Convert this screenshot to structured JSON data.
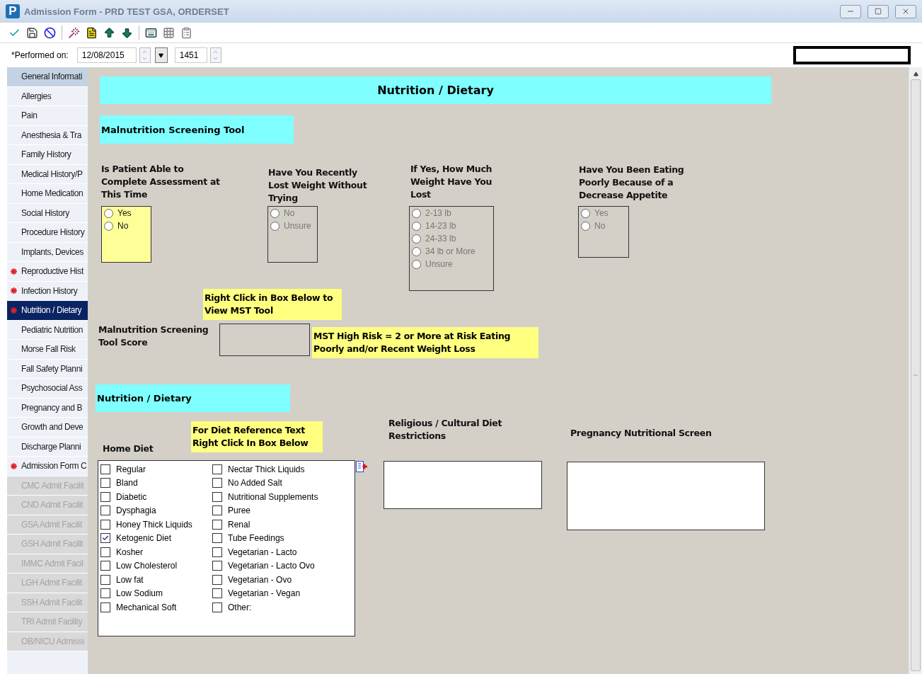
{
  "window": {
    "logo_letter": "P",
    "title": "Admission Form - PRD TEST GSA, ORDERSET"
  },
  "performed": {
    "label": "*Performed on:",
    "date": "12/08/2015",
    "time": "1451"
  },
  "sidebar": {
    "items": [
      {
        "label": "General Informati",
        "selected": false,
        "required": false,
        "disabled": false,
        "highlighted": true
      },
      {
        "label": "Allergies",
        "selected": false,
        "required": false,
        "disabled": false,
        "highlighted": false
      },
      {
        "label": "Pain",
        "selected": false,
        "required": false,
        "disabled": false,
        "highlighted": false
      },
      {
        "label": "Anesthesia & Tra",
        "selected": false,
        "required": false,
        "disabled": false,
        "highlighted": false
      },
      {
        "label": "Family History",
        "selected": false,
        "required": false,
        "disabled": false,
        "highlighted": false
      },
      {
        "label": "Medical History/P",
        "selected": false,
        "required": false,
        "disabled": false,
        "highlighted": false
      },
      {
        "label": "Home Medication",
        "selected": false,
        "required": false,
        "disabled": false,
        "highlighted": false
      },
      {
        "label": "Social History",
        "selected": false,
        "required": false,
        "disabled": false,
        "highlighted": false
      },
      {
        "label": "Procedure History",
        "selected": false,
        "required": false,
        "disabled": false,
        "highlighted": false
      },
      {
        "label": "Implants, Devices",
        "selected": false,
        "required": false,
        "disabled": false,
        "highlighted": false
      },
      {
        "label": "Reproductive Hist",
        "selected": false,
        "required": true,
        "disabled": false,
        "highlighted": false
      },
      {
        "label": "Infection History",
        "selected": false,
        "required": true,
        "disabled": false,
        "highlighted": false
      },
      {
        "label": "Nutrition / Dietary",
        "selected": true,
        "required": true,
        "disabled": false,
        "highlighted": false
      },
      {
        "label": "Pediatric Nutrition",
        "selected": false,
        "required": false,
        "disabled": false,
        "highlighted": false
      },
      {
        "label": "Morse Fall Risk",
        "selected": false,
        "required": false,
        "disabled": false,
        "highlighted": false
      },
      {
        "label": "Fall Safety Planni",
        "selected": false,
        "required": false,
        "disabled": false,
        "highlighted": false
      },
      {
        "label": "Psychosocial Ass",
        "selected": false,
        "required": false,
        "disabled": false,
        "highlighted": false
      },
      {
        "label": "Pregnancy and B",
        "selected": false,
        "required": false,
        "disabled": false,
        "highlighted": false
      },
      {
        "label": "Growth and Deve",
        "selected": false,
        "required": false,
        "disabled": false,
        "highlighted": false
      },
      {
        "label": "Discharge Planni",
        "selected": false,
        "required": false,
        "disabled": false,
        "highlighted": false
      },
      {
        "label": "Admission Form C",
        "selected": false,
        "required": true,
        "disabled": false,
        "highlighted": false
      },
      {
        "label": "CMC Admit Facilit",
        "selected": false,
        "required": false,
        "disabled": true,
        "highlighted": false
      },
      {
        "label": "CND Admit Facilit",
        "selected": false,
        "required": false,
        "disabled": true,
        "highlighted": false
      },
      {
        "label": "GSA Admit Facilit",
        "selected": false,
        "required": false,
        "disabled": true,
        "highlighted": false
      },
      {
        "label": "GSH Admit Facilit",
        "selected": false,
        "required": false,
        "disabled": true,
        "highlighted": false
      },
      {
        "label": "IMMC Admit Facil",
        "selected": false,
        "required": false,
        "disabled": true,
        "highlighted": false
      },
      {
        "label": "LGH Admit Facilit",
        "selected": false,
        "required": false,
        "disabled": true,
        "highlighted": false
      },
      {
        "label": "SSH Admit Facilit",
        "selected": false,
        "required": false,
        "disabled": true,
        "highlighted": false
      },
      {
        "label": "TRI Admit Facility",
        "selected": false,
        "required": false,
        "disabled": true,
        "highlighted": false
      },
      {
        "label": "OB/NICU Admissi",
        "selected": false,
        "required": false,
        "disabled": true,
        "highlighted": false
      }
    ]
  },
  "form": {
    "title": "Nutrition / Dietary",
    "mst_header": "Malnutrition Screening Tool",
    "questions": [
      {
        "label": "Is Patient Able to Complete Assessment at This Time",
        "required": true,
        "disabled": false,
        "options": [
          {
            "label": "Yes",
            "selected": false
          },
          {
            "label": "No",
            "selected": false
          }
        ]
      },
      {
        "label": "Have You Recently Lost Weight Without Trying",
        "required": false,
        "disabled": true,
        "options": [
          {
            "label": "No",
            "selected": false
          },
          {
            "label": "Unsure",
            "selected": false
          }
        ]
      },
      {
        "label": "If Yes, How Much Weight Have You Lost",
        "required": false,
        "disabled": true,
        "options": [
          {
            "label": "2-13 lb",
            "selected": false
          },
          {
            "label": "14-23 lb",
            "selected": false
          },
          {
            "label": "24-33 lb",
            "selected": false
          },
          {
            "label": "34 lb or More",
            "selected": false
          },
          {
            "label": "Unsure",
            "selected": false
          }
        ]
      },
      {
        "label": "Have You Been Eating Poorly Because of a Decrease Appetite",
        "required": false,
        "disabled": true,
        "options": [
          {
            "label": "Yes",
            "selected": false
          },
          {
            "label": "No",
            "selected": false
          }
        ]
      }
    ],
    "mst_note": "Right Click in Box Below to View MST Tool",
    "score_label": "Malnutrition Screening Tool Score",
    "high_risk_note": "MST High Risk = 2 or More at Risk Eating Poorly and/or Recent Weight Loss",
    "diet_header": "Nutrition / Dietary",
    "home_diet_label": "Home Diet",
    "diet_note": "For Diet Reference Text Right Click In Box Below",
    "religious_label": "Religious / Cultural Diet Restrictions",
    "pregnancy_label": "Pregnancy Nutritional Screen",
    "home_diet": [
      {
        "label": "Regular",
        "checked": false
      },
      {
        "label": "Bland",
        "checked": false
      },
      {
        "label": "Diabetic",
        "checked": false
      },
      {
        "label": "Dysphagia",
        "checked": false
      },
      {
        "label": "Honey Thick Liquids",
        "checked": false
      },
      {
        "label": "Ketogenic Diet",
        "checked": true
      },
      {
        "label": "Kosher",
        "checked": false
      },
      {
        "label": "Low Cholesterol",
        "checked": false
      },
      {
        "label": "Low fat",
        "checked": false
      },
      {
        "label": "Low Sodium",
        "checked": false
      },
      {
        "label": "Mechanical Soft",
        "checked": false
      },
      {
        "label": "Nectar Thick Liquids",
        "checked": false
      },
      {
        "label": "No Added Salt",
        "checked": false
      },
      {
        "label": "Nutritional Supplements",
        "checked": false
      },
      {
        "label": "Puree",
        "checked": false
      },
      {
        "label": "Renal",
        "checked": false
      },
      {
        "label": "Tube Feedings",
        "checked": false
      },
      {
        "label": "Vegetarian - Lacto",
        "checked": false
      },
      {
        "label": "Vegetarian - Lacto Ovo",
        "checked": false
      },
      {
        "label": "Vegetarian - Ovo",
        "checked": false
      },
      {
        "label": "Vegetarian - Vegan",
        "checked": false
      },
      {
        "label": "Other:",
        "checked": false
      }
    ]
  }
}
